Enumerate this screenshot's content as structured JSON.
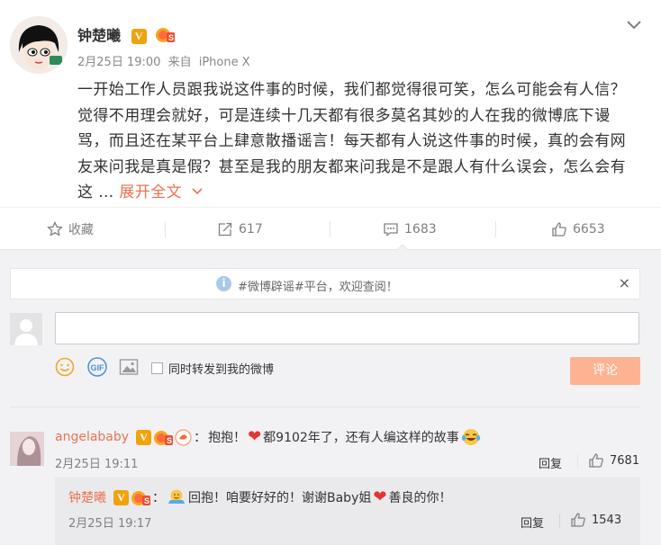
{
  "post": {
    "author": "钟楚曦",
    "verified_badge": "V",
    "time": "2月25日 19:00",
    "source_prefix": "来自",
    "source": "iPhone X",
    "lines": [
      "一开始工作人员跟我说这件事的时候，我们都觉得很可笑，怎么可能会有人信？",
      "觉得不用理会就好，可是连续十几天都有很多莫名其妙的人在我的微博底下谩",
      "骂，而且还在某平台上肆意散播谣言！每天都有人说这件事的时候，真的会有网",
      "友来问我是真是假？甚至是我的朋友都来问我是不是跟人有什么误会，怎么会有",
      "这 ... "
    ],
    "expand_label": "展开全文"
  },
  "actions": {
    "favorite": "收藏",
    "repost": "617",
    "comment": "1683",
    "like": "6653"
  },
  "notice": {
    "text": "#微博辟谣#平台，欢迎查阅！",
    "close": "×"
  },
  "composer": {
    "input_value": "",
    "forward_label": "同时转发到我的微博",
    "submit_label": "评论",
    "icons": [
      "smile-icon",
      "gif-icon",
      "image-icon"
    ]
  },
  "comments": [
    {
      "author": "angelababy",
      "badge": "V",
      "sep": "：",
      "text_a": "抱抱！",
      "text_b": "都9102年了，还有人编这样的故事",
      "time": "2月25日 19:11",
      "reply_label": "回复",
      "likes": "7681"
    }
  ],
  "sub_reply": {
    "author": "钟楚曦",
    "badge": "V",
    "sep": "：",
    "text_a": "回抱！咱要好好的！谢谢Baby姐",
    "text_b": "善良的你！",
    "time": "2月25日 19:17",
    "reply_label": "回复",
    "likes": "1543"
  },
  "colors": {
    "accent": "#eb7350",
    "submit_disabled": "#fdb391",
    "verified": "#f0a30a",
    "background_grey": "#f2f2f5"
  }
}
